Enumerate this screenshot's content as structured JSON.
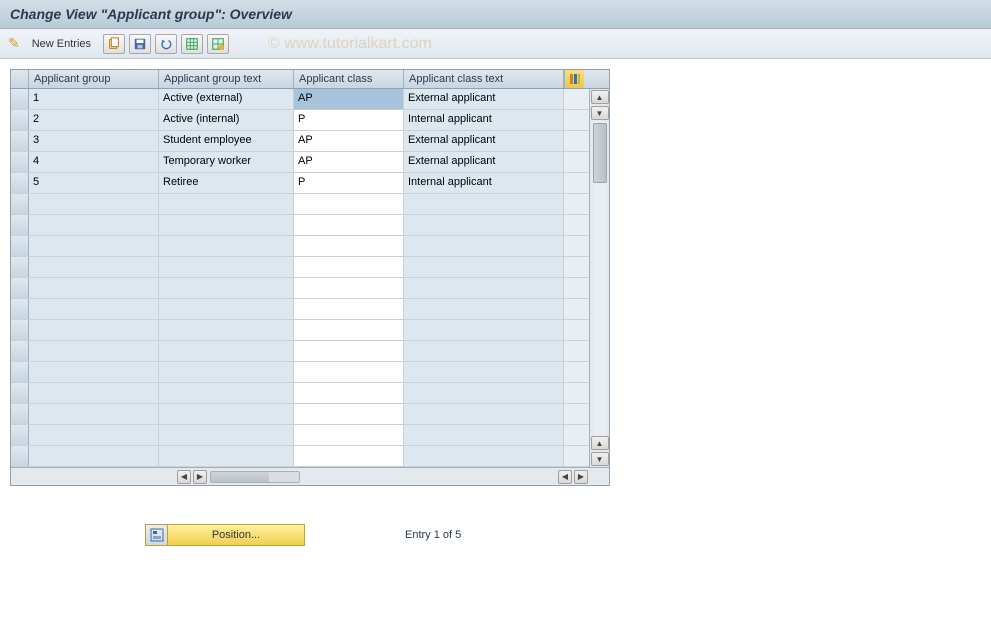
{
  "title": "Change View \"Applicant group\": Overview",
  "watermark": "© www.tutorialkart.com",
  "toolbar": {
    "new_entries": "New Entries"
  },
  "columns": {
    "c1": "Applicant group",
    "c2": "Applicant group text",
    "c3": "Applicant class",
    "c4": "Applicant class text"
  },
  "rows": [
    {
      "group": "1",
      "group_text": "Active (external)",
      "class": "AP",
      "class_text": "External applicant",
      "class_selected": true
    },
    {
      "group": "2",
      "group_text": "Active (internal)",
      "class": "P",
      "class_text": "Internal applicant"
    },
    {
      "group": "3",
      "group_text": "Student employee",
      "class": "AP",
      "class_text": "External applicant"
    },
    {
      "group": "4",
      "group_text": "Temporary worker",
      "class": "AP",
      "class_text": "External applicant"
    },
    {
      "group": "5",
      "group_text": "Retiree",
      "class": "P",
      "class_text": "Internal applicant"
    }
  ],
  "empty_rows": 13,
  "footer": {
    "position_label": "Position...",
    "entry_status": "Entry 1 of 5"
  }
}
